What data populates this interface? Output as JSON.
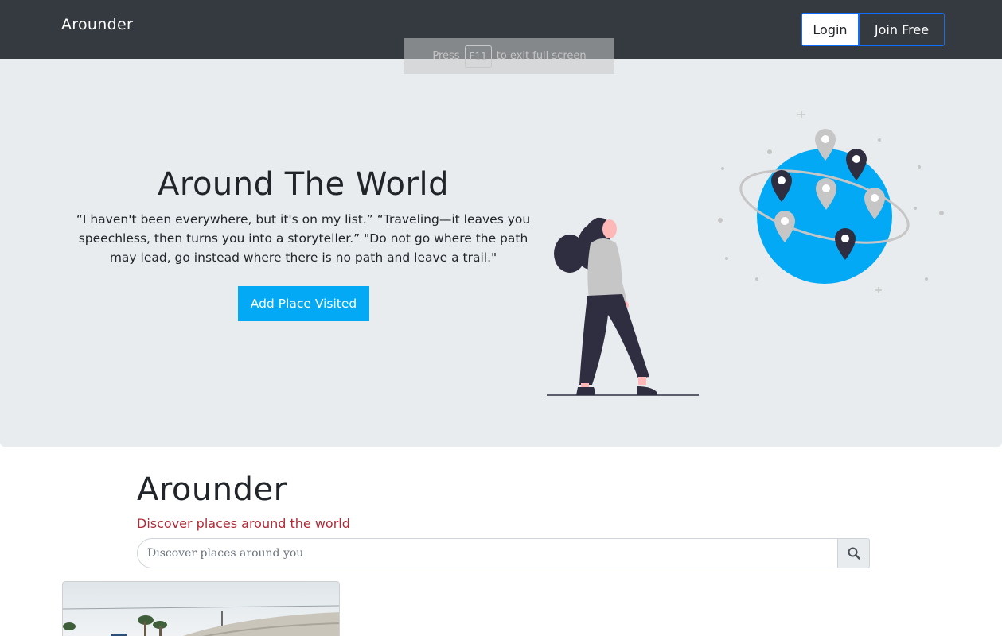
{
  "navbar": {
    "brand": "Arounder",
    "login_label": "Login",
    "join_label": "Join Free"
  },
  "fullscreen_notice": {
    "prefix": "Press",
    "key": "F11",
    "suffix": "to exit full screen"
  },
  "hero": {
    "title": "Around The World",
    "quote": "“I haven't been everywhere, but it's on my list.” “Traveling—it leaves you speechless, then turns you into a storyteller.” \"Do not go where the path may lead, go instead where there is no path and leave a trail.\"",
    "cta_label": "Add Place Visited"
  },
  "main": {
    "title": "Arounder",
    "subtitle": "Discover places around the world",
    "search": {
      "placeholder": "Discover places around you",
      "value": ""
    }
  },
  "icons": {
    "search": "search-icon",
    "map_pin": "map-pin-icon"
  },
  "colors": {
    "navbar_bg": "#343a40",
    "hero_bg": "#e9ecef",
    "accent_blue": "#03a9f4",
    "globe_blue": "#03a9f4",
    "subtitle_red": "#b02a37",
    "pin_dark": "#2f2e41",
    "pin_light": "#c6c6c6"
  }
}
